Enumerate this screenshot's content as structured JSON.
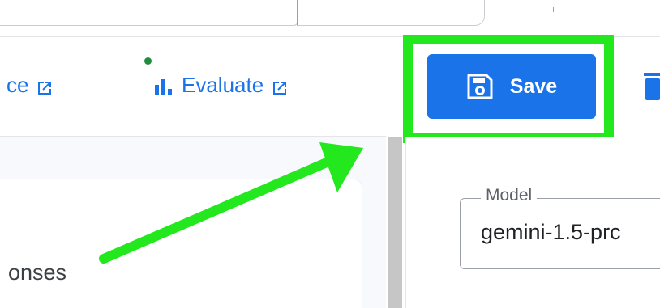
{
  "toolbar": {
    "link_1_label": "ce",
    "link_2_label": "Evaluate",
    "save_label": "Save"
  },
  "left_pane": {
    "card_text": "onses"
  },
  "right_pane": {
    "model_field": {
      "label": "Model",
      "value": "gemini-1.5-prc"
    }
  },
  "colors": {
    "accent": "#1a73e8",
    "highlight": "#22e81d",
    "notification_dot": "#1e8e3e"
  },
  "icons": {
    "external_link": "external-link-icon",
    "evaluate": "bar-chart-icon",
    "save": "save-icon",
    "delete": "trash-icon"
  }
}
